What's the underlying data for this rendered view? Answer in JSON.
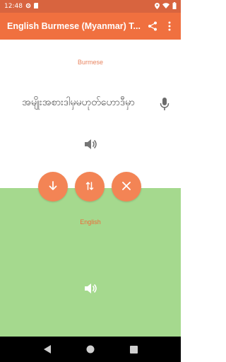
{
  "status_bar": {
    "time": "12:48",
    "icons": [
      "gear-icon",
      "sd-card-icon",
      "location-icon",
      "wifi-icon",
      "battery-icon"
    ]
  },
  "app_bar": {
    "title": "English Burmese (Myanmar) T...",
    "actions": [
      "share-icon",
      "more-vert-icon"
    ]
  },
  "source": {
    "language": "Burmese",
    "text": "အမျိုးအစားဒါမှမဟုတ်ဟောဒီမှာ",
    "icons": [
      "mic-icon",
      "speaker-icon"
    ]
  },
  "actions": [
    "arrow-down-icon",
    "swap-icon",
    "close-icon"
  ],
  "target": {
    "language": "English",
    "text": "",
    "icons": [
      "speaker-icon"
    ]
  },
  "nav_bar": [
    "back-icon",
    "home-icon",
    "recents-icon"
  ],
  "colors": {
    "status_bar": "#d8643f",
    "app_bar": "#f0703f",
    "fab": "#f38455",
    "target_panel": "#a5d98e",
    "label": "#e8845f"
  }
}
